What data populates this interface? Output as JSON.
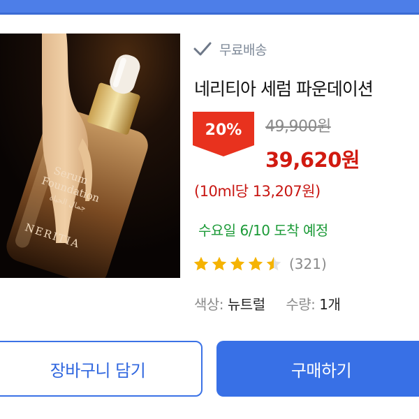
{
  "colors": {
    "accent": "#3870e6",
    "sale_red": "#d11a10",
    "delivery_green": "#1b9a37",
    "star_gold": "#f5b301"
  },
  "product": {
    "image_icon": "serum-foundation-bottle",
    "image_label_line1": "Serum",
    "image_label_line2": "Foundation",
    "image_label_script": "جمال الحياة",
    "image_brand": "NERITIA"
  },
  "shipping": {
    "icon": "check-icon",
    "label": "무료배송"
  },
  "title": "네리티아 세럼 파운데이션",
  "pricing": {
    "discount": "20%",
    "original_price": "49,900원",
    "sale_price": "39,620원",
    "unit_price": "(10ml당 13,207원)"
  },
  "delivery": "수요일 6/10 도착 예정",
  "rating": {
    "stars": 4.5,
    "max": 5,
    "count": "(321)"
  },
  "options": {
    "color_label": "색상:",
    "color_value": "뉴트럴",
    "qty_label": "수량:",
    "qty_value": "1개"
  },
  "actions": {
    "cart_label": "장바구니 담기",
    "buy_label": "구매하기"
  }
}
